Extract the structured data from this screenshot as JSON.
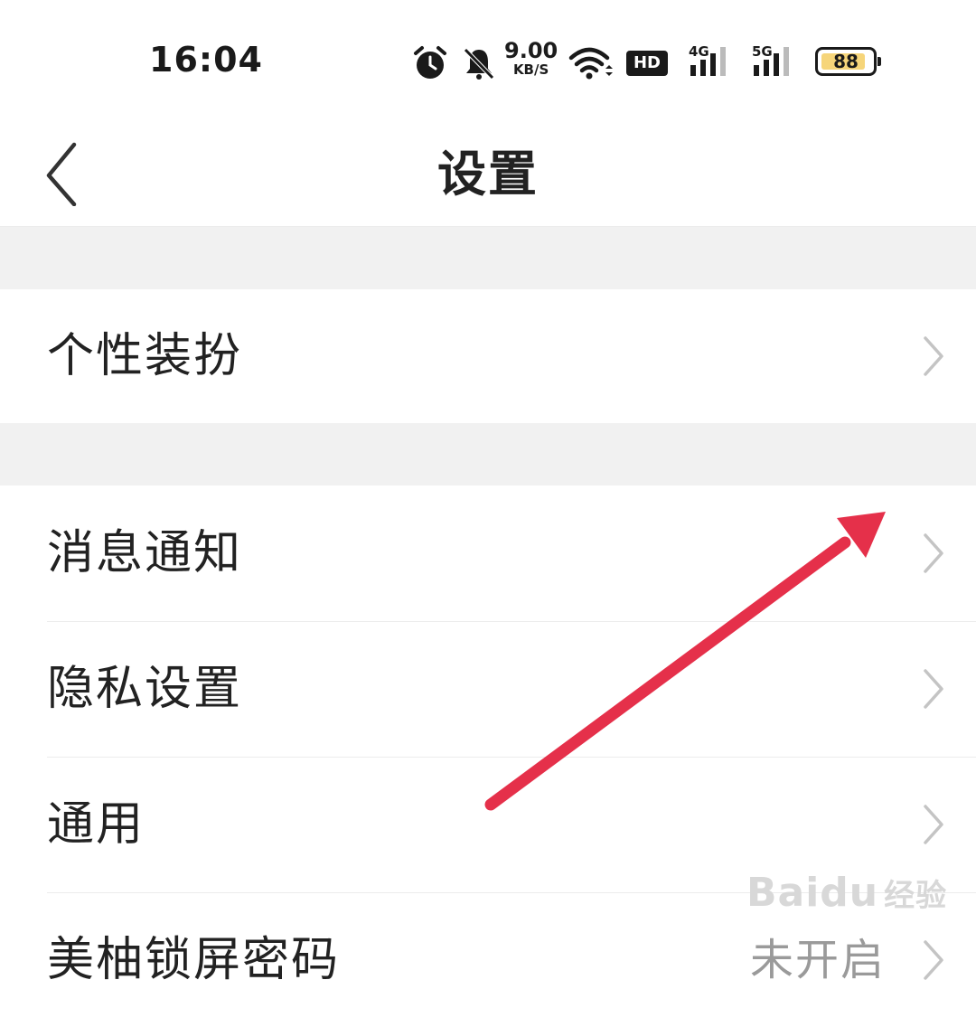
{
  "status_bar": {
    "time": "16:04",
    "net_speed_value": "9.00",
    "net_speed_unit": "KB/S",
    "hd_badge": "HD",
    "sim1_label": "4G",
    "sim2_label": "5G",
    "battery": "88",
    "battery_level": 0.88,
    "icons": [
      "alarm-icon",
      "bell-off-icon",
      "wifi-icon",
      "hd-icon",
      "signal-4g-icon",
      "signal-5g-icon",
      "battery-icon"
    ]
  },
  "nav": {
    "title": "设置",
    "back_icon": "chevron-left-icon"
  },
  "sections": [
    {
      "items": [
        {
          "label": "个性装扮"
        }
      ]
    },
    {
      "items": [
        {
          "label": "消息通知"
        },
        {
          "label": "隐私设置"
        },
        {
          "label": "通用"
        },
        {
          "label": "美柚锁屏密码",
          "value": "未开启"
        }
      ]
    }
  ],
  "watermark": {
    "brand": "Baidu",
    "text": "经验"
  },
  "colors": {
    "annotation_arrow": "#e5304a",
    "divider": "#ececec",
    "section_gap": "#f1f1f1",
    "battery_fill": "#f6d57a"
  }
}
